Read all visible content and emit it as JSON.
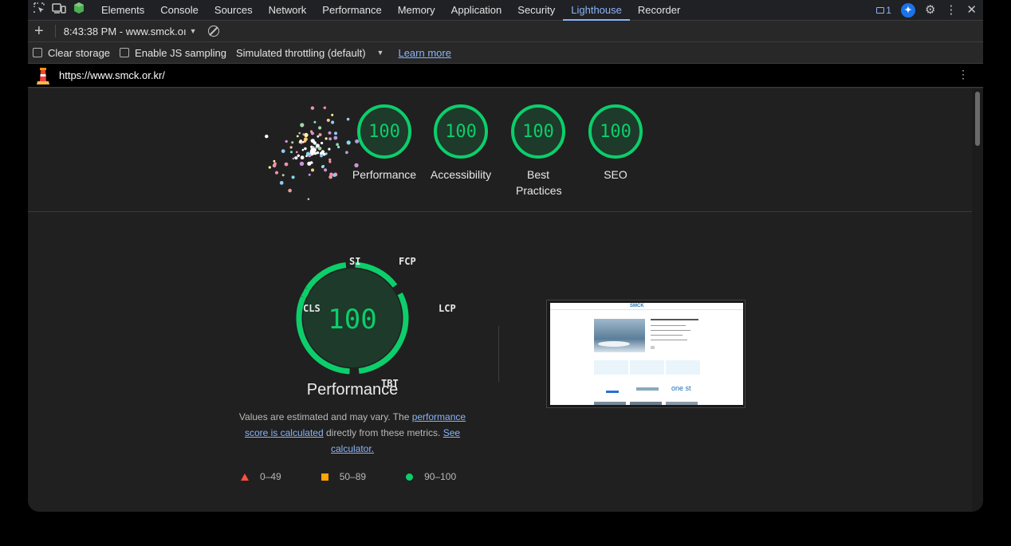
{
  "devtools_tabs": [
    "Elements",
    "Console",
    "Sources",
    "Network",
    "Performance",
    "Memory",
    "Application",
    "Security",
    "Lighthouse",
    "Recorder"
  ],
  "active_tab": "Lighthouse",
  "issues_count": "1",
  "report_selector": "8:43:38 PM - www.smck.oı",
  "options": {
    "clear_storage": "Clear storage",
    "enable_js_sampling": "Enable JS sampling",
    "throttling": "Simulated throttling (default)",
    "learn_more": "Learn more"
  },
  "url": "https://www.smck.or.kr/",
  "scores": [
    {
      "value": "100",
      "label": "Performance"
    },
    {
      "value": "100",
      "label": "Accessibility"
    },
    {
      "value": "100",
      "label": "Best Practices"
    },
    {
      "value": "100",
      "label": "SEO"
    }
  ],
  "performance": {
    "score": "100",
    "title": "Performance",
    "metrics": [
      "SI",
      "FCP",
      "LCP",
      "TBT",
      "CLS"
    ],
    "desc_prefix": "Values are estimated and may vary. The ",
    "desc_link1": "performance score is calculated",
    "desc_middle": " directly from these metrics. ",
    "desc_link2": "See calculator."
  },
  "legend": [
    {
      "shape": "triangle",
      "range": "0–49",
      "color": "#ff4e42"
    },
    {
      "shape": "square",
      "range": "50–89",
      "color": "#ffa400"
    },
    {
      "shape": "circle",
      "range": "90–100",
      "color": "#0cce6b"
    }
  ],
  "screenshot_texts": {
    "logo": "SMCK",
    "brand2": "one st"
  },
  "colors": {
    "accent": "#8ab4f8",
    "pass": "#0cce6b"
  }
}
